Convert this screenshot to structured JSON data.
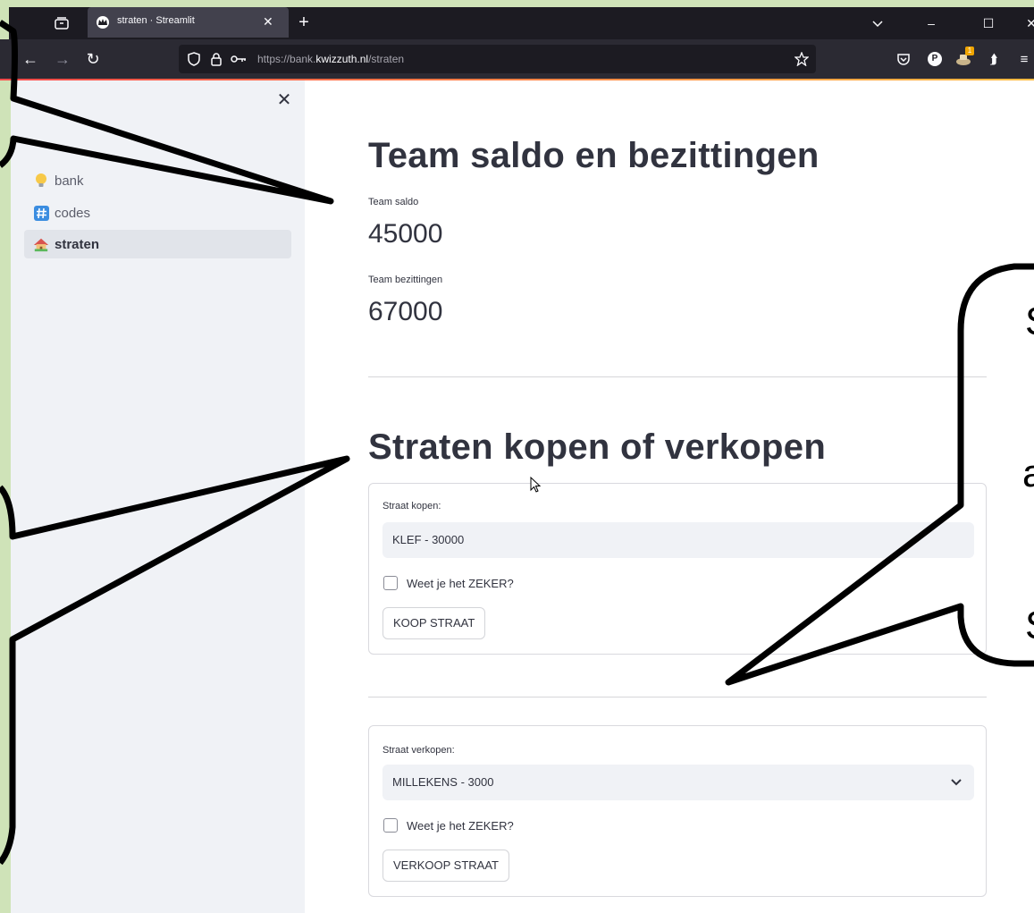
{
  "browser": {
    "tab_title": "straten · Streamlit",
    "url_prefix": "https://bank.",
    "url_host": "kwizzuth.nl",
    "url_path": "/straten",
    "extension_badge": "1",
    "profile_letter": "P"
  },
  "sidebar": {
    "items": [
      {
        "label": "bank",
        "icon": "lightbulb-icon",
        "active": false
      },
      {
        "label": "codes",
        "icon": "hash-icon",
        "active": false
      },
      {
        "label": "straten",
        "icon": "house-icon",
        "active": true
      }
    ]
  },
  "main": {
    "title1": "Team saldo en bezittingen",
    "saldo_label": "Team saldo",
    "saldo_value": "45000",
    "bezit_label": "Team bezittingen",
    "bezit_value": "67000",
    "title2": "Straten kopen of verkopen",
    "buy": {
      "label": "Straat kopen:",
      "selected": "KLEF - 30000",
      "confirm": "Weet je het ZEKER?",
      "button": "KOOP STRAAT"
    },
    "sell": {
      "label": "Straat verkopen:",
      "selected": "MILLEKENS - 3000",
      "confirm": "Weet je het ZEKER?",
      "button": "VERKOOP STRAAT"
    }
  },
  "overlay": {
    "bubble_letters": [
      "S",
      "a",
      "S"
    ]
  },
  "colors": {
    "primary_text": "#31333f",
    "sidebar_bg": "#f0f2f6",
    "page_border": "#cfe3b8"
  }
}
